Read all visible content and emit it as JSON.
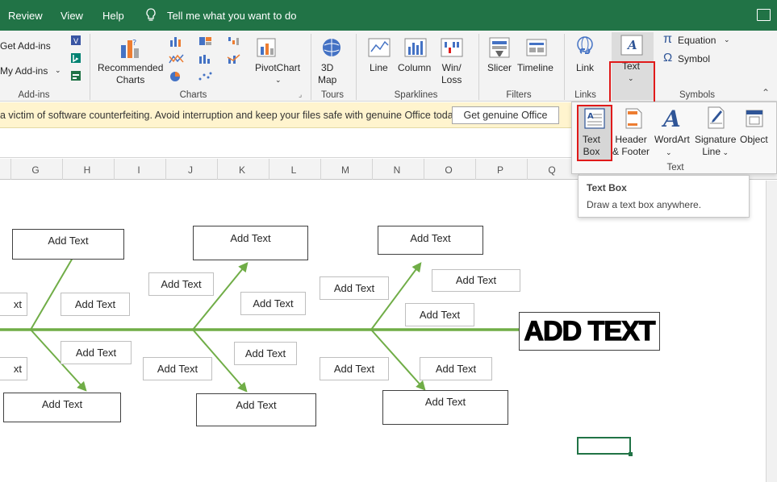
{
  "menu": {
    "review": "Review",
    "view": "View",
    "help": "Help",
    "tell_me": "Tell me what you want to do"
  },
  "ribbon": {
    "addins": {
      "get_addins": "Get Add-ins",
      "my_addins": "My Add-ins",
      "group": "Add-ins"
    },
    "charts": {
      "recommended": [
        "Recommended",
        "Charts"
      ],
      "pivotchart": "PivotChart",
      "group": "Charts"
    },
    "tours": {
      "map3d": [
        "3D",
        "Map"
      ],
      "group": "Tours"
    },
    "sparklines": {
      "line": "Line",
      "column": "Column",
      "winloss": [
        "Win/",
        "Loss"
      ],
      "group": "Sparklines"
    },
    "filters": {
      "slicer": "Slicer",
      "timeline": "Timeline",
      "group": "Filters"
    },
    "links": {
      "link": "Link",
      "group": "Links"
    },
    "text": {
      "text": "Text"
    },
    "symbols": {
      "equation": "Equation",
      "symbol": "Symbol",
      "group": "Symbols"
    }
  },
  "infobar": {
    "message": "a victim of software counterfeiting. Avoid interruption and keep your files safe with genuine Office today.",
    "button": "Get genuine Office"
  },
  "columns": [
    "G",
    "H",
    "I",
    "J",
    "K",
    "L",
    "M",
    "N",
    "O",
    "P",
    "Q"
  ],
  "dropdown": {
    "items": [
      {
        "label": [
          "Text",
          "Box"
        ]
      },
      {
        "label": [
          "Header",
          "& Footer"
        ]
      },
      {
        "label": [
          "WordArt"
        ]
      },
      {
        "label": [
          "Signature",
          "Line"
        ]
      },
      {
        "label": [
          "Object"
        ]
      }
    ],
    "group": "Text"
  },
  "tooltip": {
    "title": "Text Box",
    "description": "Draw a text box anywhere."
  },
  "diagram": {
    "placeholder": "Add Text",
    "partial": "xt",
    "head": "ADD TEXT"
  },
  "colors": {
    "title_bar": "#217346",
    "spine": "#70ad47",
    "highlight": "#e01a1a",
    "infobar": "#fff4ce"
  }
}
